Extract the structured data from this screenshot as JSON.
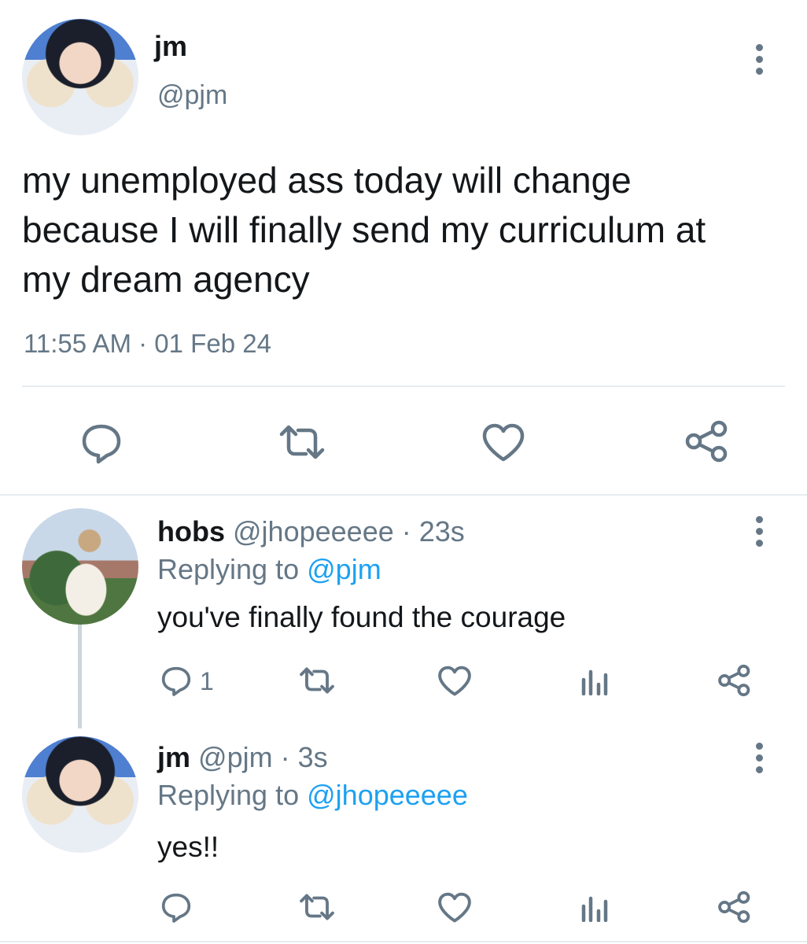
{
  "main_tweet": {
    "display_name": "jm",
    "handle": "@pjm",
    "text_lines": [
      "my unemployed ass today will change",
      "because I will finally send my curriculum at",
      "my dream agency"
    ],
    "timestamp": "11:55 AM · 01 Feb 24",
    "actions": [
      "reply-icon",
      "retweet-icon",
      "like-icon",
      "share-icon"
    ]
  },
  "replies": [
    {
      "display_name": "hobs",
      "handle": "@jhopeeeee",
      "age": "· 23s",
      "replying_prefix": "Replying to",
      "replying_to": "@pjm",
      "text": "you've finally found the courage",
      "reply_count": "1"
    },
    {
      "display_name": "jm",
      "handle": "@pjm",
      "age": "· 3s",
      "replying_prefix": "Replying to",
      "replying_to": "@jhopeeeee",
      "text": "yes!!",
      "reply_count": ""
    }
  ],
  "colors": {
    "text": "#14171a",
    "secondary": "#657786",
    "accent": "#1da1f2",
    "divider": "#e6ecf0"
  }
}
